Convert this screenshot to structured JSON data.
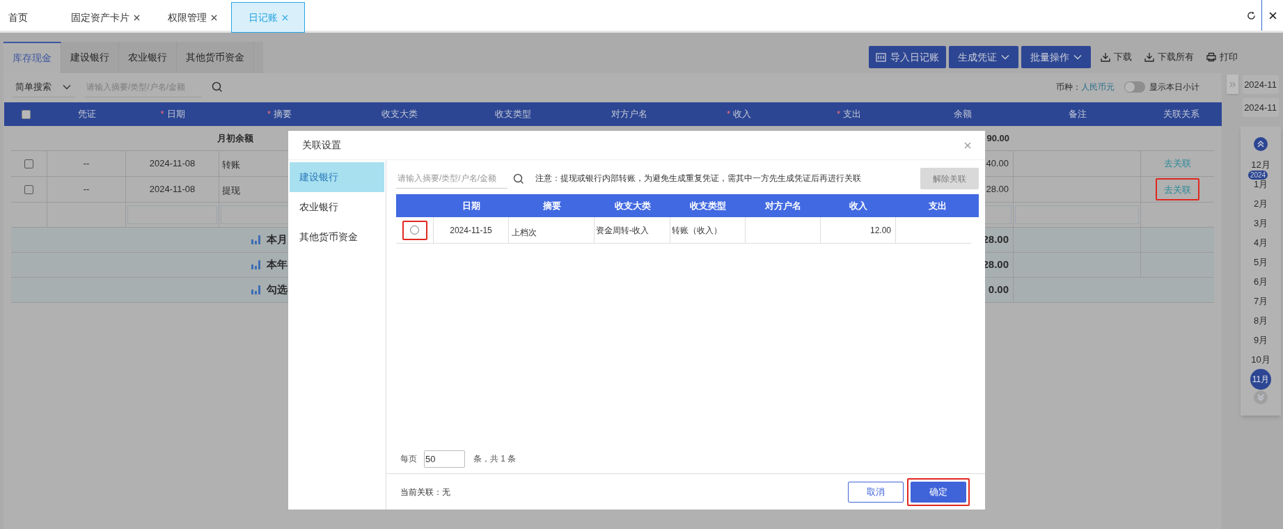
{
  "top_tabs": [
    {
      "label": "首页",
      "closable": false,
      "selected": false
    },
    {
      "label": "固定资产卡片",
      "closable": true,
      "selected": false
    },
    {
      "label": "权限管理",
      "closable": true,
      "selected": false
    },
    {
      "label": "日记账",
      "closable": true,
      "selected": true
    }
  ],
  "account_tabs": [
    {
      "label": "库存现金",
      "selected": true
    },
    {
      "label": "建设银行",
      "selected": false
    },
    {
      "label": "农业银行",
      "selected": false
    },
    {
      "label": "其他货币资金",
      "selected": false
    }
  ],
  "toolbar": [
    {
      "label": "导入日记账",
      "kind": "import"
    },
    {
      "label": "生成凭证",
      "kind": "dropdown"
    },
    {
      "label": "批量操作",
      "kind": "dropdown"
    },
    {
      "label": "下载",
      "kind": "download"
    },
    {
      "label": "下载所有",
      "kind": "download"
    },
    {
      "label": "打印",
      "kind": "print"
    }
  ],
  "search": {
    "mode": "简单搜索",
    "placeholder": "请输入摘要/类型/户名/金额"
  },
  "currency": {
    "label": "币种：",
    "value": "人民币元"
  },
  "daily_subtotal": {
    "label": "显示本日小计",
    "on": false
  },
  "table": {
    "header_checked": false,
    "columns": [
      {
        "label": "凭证"
      },
      {
        "label": "日期",
        "required_mark": "*"
      },
      {
        "label": "摘要",
        "required_mark": "*"
      },
      {
        "label": "收支大类"
      },
      {
        "label": "收支类型"
      },
      {
        "label": "对方户名"
      },
      {
        "label": "收入",
        "required_mark": "*"
      },
      {
        "label": "支出",
        "required_mark": "*"
      },
      {
        "label": "余额"
      },
      {
        "label": "备注"
      },
      {
        "label": "关联关系"
      }
    ],
    "opening_row": {
      "label": "月初余额",
      "balance": "90.00"
    },
    "rows": [
      {
        "checked": false,
        "voucher": "--",
        "date": "2024-11-08",
        "summary": "转账",
        "balance": "40.00",
        "link": "去关联",
        "highlighted": false
      },
      {
        "checked": false,
        "voucher": "--",
        "date": "2024-11-08",
        "summary": "提现",
        "balance": "28.00",
        "link": "去关联",
        "highlighted": true
      }
    ],
    "totals": [
      {
        "label": "本月",
        "balance": "28.00"
      },
      {
        "label": "本年",
        "balance": "28.00"
      },
      {
        "label": "勾选",
        "balance": "0.00"
      }
    ]
  },
  "date_panel": {
    "periods": [
      "2024-11",
      "2024-11"
    ],
    "year_badge": "2024",
    "months": [
      {
        "label": "12月",
        "selected": false
      },
      {
        "label": "1月",
        "selected": false
      },
      {
        "label": "2月",
        "selected": false
      },
      {
        "label": "3月",
        "selected": false
      },
      {
        "label": "4月",
        "selected": false
      },
      {
        "label": "5月",
        "selected": false
      },
      {
        "label": "6月",
        "selected": false
      },
      {
        "label": "7月",
        "selected": false
      },
      {
        "label": "8月",
        "selected": false
      },
      {
        "label": "9月",
        "selected": false
      },
      {
        "label": "10月",
        "selected": false
      },
      {
        "label": "11月",
        "selected": true
      }
    ]
  },
  "modal": {
    "title": "关联设置",
    "nav": [
      {
        "label": "建设银行",
        "selected": true
      },
      {
        "label": "农业银行",
        "selected": false
      },
      {
        "label": "其他货币资金",
        "selected": false
      }
    ],
    "search_placeholder": "请输入摘要/类型/户名/金额",
    "notice": "注意：提现或银行内部转账，为避免生成重复凭证，需其中一方先生成凭证后再进行关联",
    "unlink_button": {
      "label": "解除关联",
      "disabled": true
    },
    "columns": [
      "日期",
      "摘要",
      "收支大类",
      "收支类型",
      "对方户名",
      "收入",
      "支出"
    ],
    "rows": [
      {
        "selected": false,
        "highlighted": true,
        "date": "2024-11-15",
        "summary": "上档次",
        "category": "资金周转-收入",
        "type": "转账（收入）",
        "income": "12.00"
      }
    ],
    "pagination": {
      "per_page_label": "每页",
      "per_page": "50",
      "total": "条，共 1 条"
    },
    "current_link": "当前关联：无",
    "buttons": [
      {
        "label": "取消",
        "kind": "secondary",
        "highlighted": false
      },
      {
        "label": "确定",
        "kind": "primary",
        "highlighted": true
      }
    ]
  }
}
